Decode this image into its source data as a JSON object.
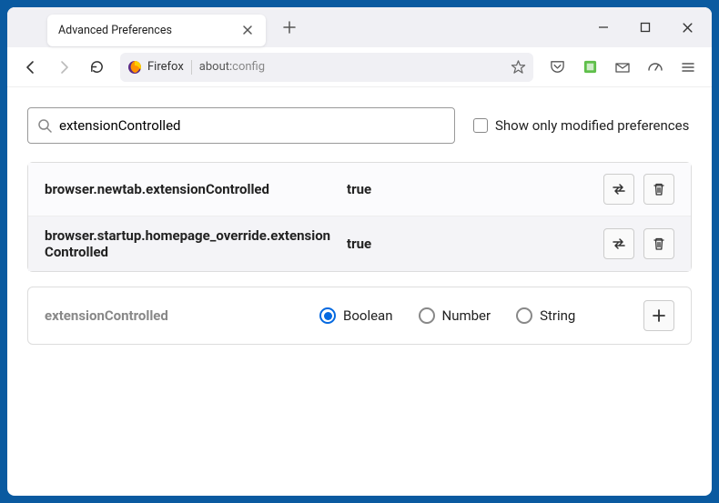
{
  "titlebar": {
    "tab_title": "Advanced Preferences"
  },
  "urlbar": {
    "identity_label": "Firefox",
    "url_scheme": "about:",
    "url_path": "config"
  },
  "search": {
    "value": "extensionControlled",
    "checkbox_label": "Show only modified preferences"
  },
  "prefs": [
    {
      "name": "browser.newtab.extensionControlled",
      "value": "true"
    },
    {
      "name": "browser.startup.homepage_override.extensionControlled",
      "value": "true"
    }
  ],
  "new_pref": {
    "name": "extensionControlled",
    "types": [
      "Boolean",
      "Number",
      "String"
    ],
    "selected": "Boolean"
  }
}
